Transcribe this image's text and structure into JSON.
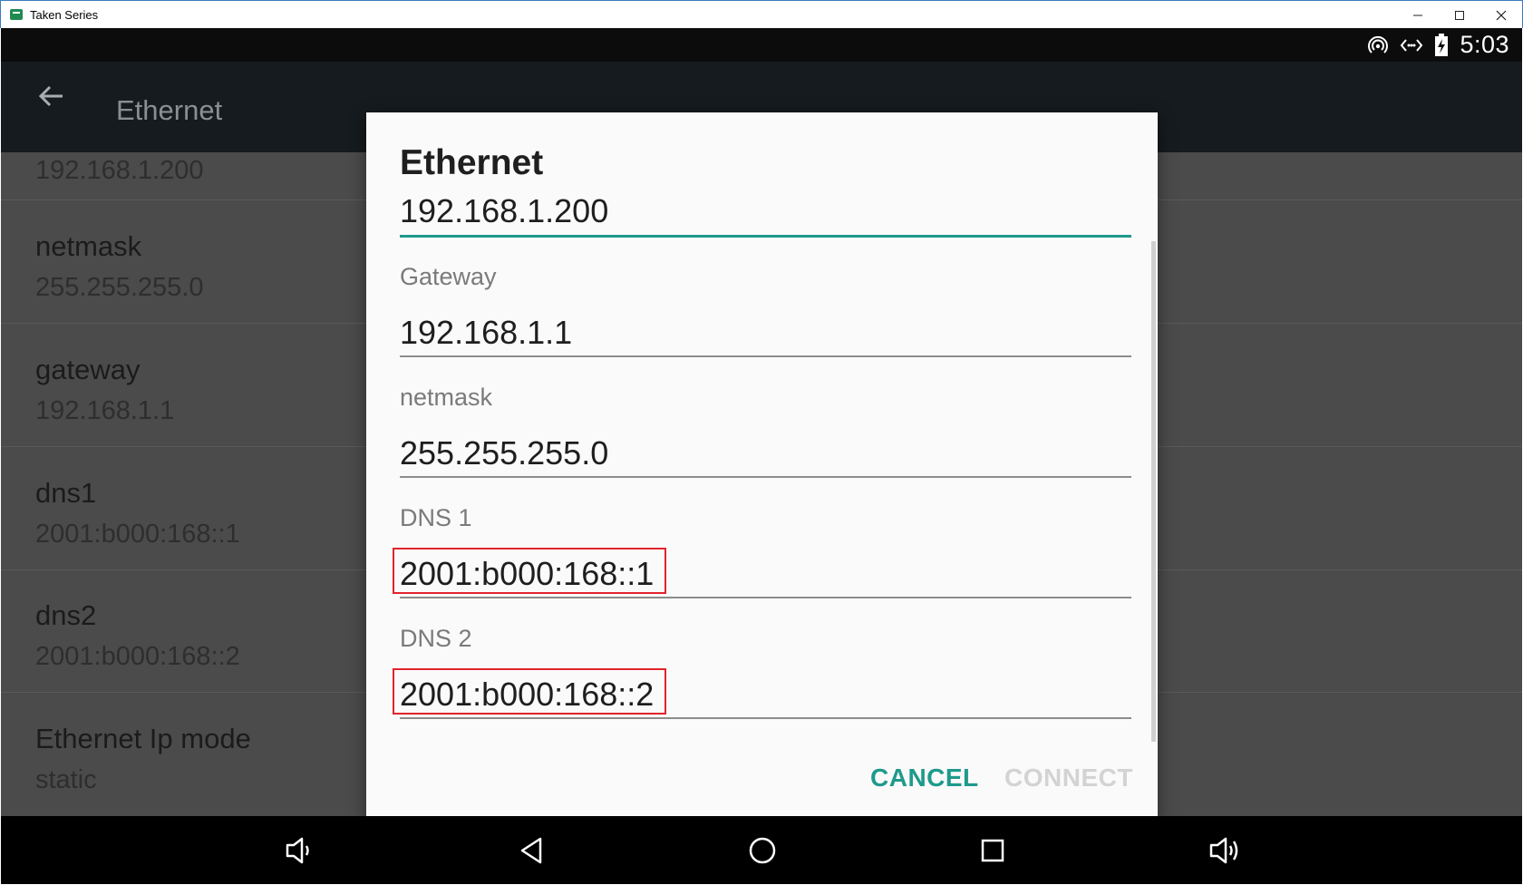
{
  "window": {
    "title": "Taken Series",
    "controls": [
      "minimize",
      "maximize",
      "close"
    ]
  },
  "status_bar": {
    "icons": [
      "hotspot-icon",
      "ethernet-icon",
      "battery-charging-icon"
    ],
    "time": "5:03"
  },
  "app_bar": {
    "back_icon": "arrow-left-icon",
    "title": "Ethernet"
  },
  "settings_list": {
    "partial_value": "192.168.1.200",
    "items": [
      {
        "title": "netmask",
        "value": "255.255.255.0"
      },
      {
        "title": "gateway",
        "value": "192.168.1.1"
      },
      {
        "title": "dns1",
        "value": "2001:b000:168::1"
      },
      {
        "title": "dns2",
        "value": "2001:b000:168::2"
      },
      {
        "title": "Ethernet Ip mode",
        "value": "static"
      }
    ]
  },
  "dialog": {
    "title": "Ethernet",
    "ip_value": "192.168.1.200",
    "fields": [
      {
        "label": "Gateway",
        "value": "192.168.1.1"
      },
      {
        "label": "netmask",
        "value": "255.255.255.0"
      },
      {
        "label": "DNS 1",
        "value": "2001:b000:168::1"
      },
      {
        "label": "DNS 2",
        "value": "2001:b000:168::2"
      }
    ],
    "cancel_label": "CANCEL",
    "connect_label": "CONNECT",
    "accent_color": "#1e9a8c",
    "highlight_color": "#e0242b"
  },
  "nav_bar": {
    "buttons": [
      "volume-down-icon",
      "back-icon",
      "home-icon",
      "recents-icon",
      "volume-up-icon"
    ]
  }
}
